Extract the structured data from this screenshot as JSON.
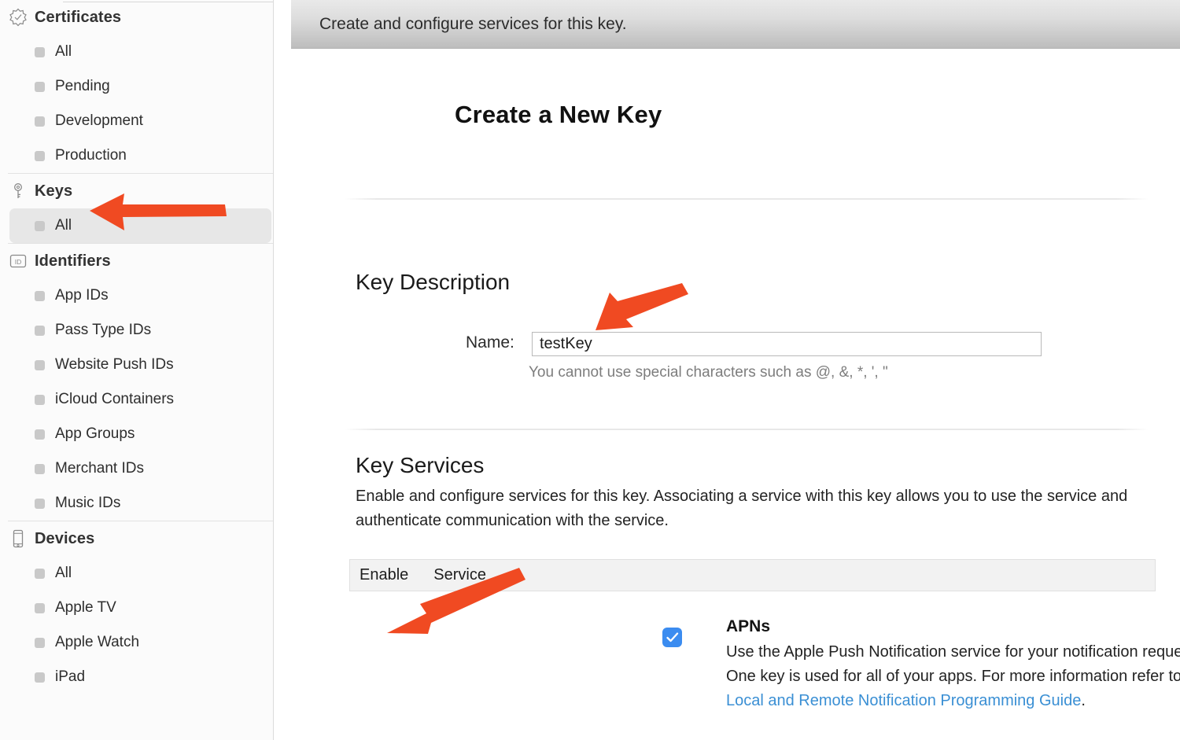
{
  "sidebar": {
    "sections": [
      {
        "id": "certificates",
        "title": "Certificates",
        "icon": "certificate-badge-icon",
        "items": [
          {
            "label": "All",
            "selected": false
          },
          {
            "label": "Pending",
            "selected": false
          },
          {
            "label": "Development",
            "selected": false
          },
          {
            "label": "Production",
            "selected": false
          }
        ]
      },
      {
        "id": "keys",
        "title": "Keys",
        "icon": "key-icon",
        "items": [
          {
            "label": "All",
            "selected": true
          }
        ]
      },
      {
        "id": "identifiers",
        "title": "Identifiers",
        "icon": "id-box-icon",
        "items": [
          {
            "label": "App IDs",
            "selected": false
          },
          {
            "label": "Pass Type IDs",
            "selected": false
          },
          {
            "label": "Website Push IDs",
            "selected": false
          },
          {
            "label": "iCloud Containers",
            "selected": false
          },
          {
            "label": "App Groups",
            "selected": false
          },
          {
            "label": "Merchant IDs",
            "selected": false
          },
          {
            "label": "Music IDs",
            "selected": false
          }
        ]
      },
      {
        "id": "devices",
        "title": "Devices",
        "icon": "iphone-icon",
        "items": [
          {
            "label": "All",
            "selected": false
          },
          {
            "label": "Apple TV",
            "selected": false
          },
          {
            "label": "Apple Watch",
            "selected": false
          },
          {
            "label": "iPad",
            "selected": false
          }
        ]
      }
    ]
  },
  "banner": {
    "text": "Create and configure services for this key."
  },
  "main": {
    "page_title": "Create a New Key",
    "key_description": {
      "heading": "Key Description",
      "name_label": "Name:",
      "name_value": "testKey",
      "name_placeholder": "",
      "hint": "You cannot use special characters such as @, &, *, ', \""
    },
    "key_services": {
      "heading": "Key Services",
      "description": "Enable and configure services for this key. Associating a service with this key allows you to use the service and authenticate communication with the service.",
      "table": {
        "columns": [
          "Enable",
          "Service"
        ],
        "rows": [
          {
            "enabled": true,
            "name": "APNs",
            "description_before_link": "Use the Apple Push Notification service for your notification requests. One key is used for all of your apps. For more information refer to the ",
            "link_text": "Local and Remote Notification Programming Guide",
            "description_after_link": "."
          }
        ]
      }
    }
  },
  "annotations": {
    "arrow_color": "#F04A22",
    "arrows": [
      {
        "name": "arrow-to-keys",
        "target": "Keys"
      },
      {
        "name": "arrow-to-name-field",
        "target": "Name input"
      },
      {
        "name": "arrow-to-apns-checkbox",
        "target": "APNs checkbox"
      }
    ]
  },
  "colors": {
    "accent_blue": "#3B8CF0",
    "link_blue": "#3A8FD4",
    "sidebar_bg": "#FBFBFB",
    "selected_row": "#E7E7E7",
    "banner_gray": "#C3C3C3"
  }
}
